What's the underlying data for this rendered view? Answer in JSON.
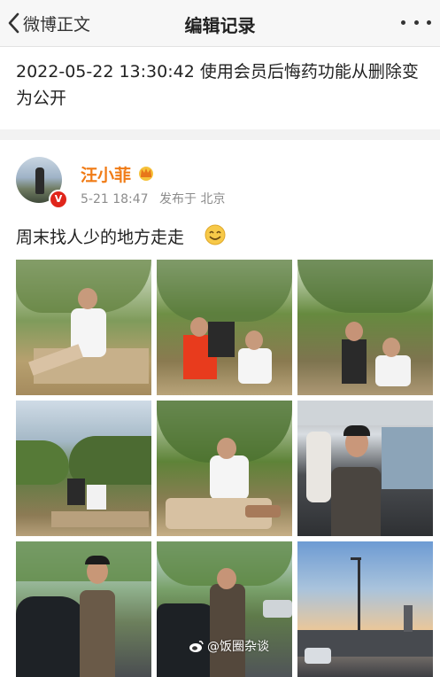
{
  "nav": {
    "back_label": "微博正文",
    "title": "编辑记录"
  },
  "record": {
    "text": "2022-05-22 13:30:42 使用会员后悔药功能从删除变为公开"
  },
  "post": {
    "author": "汪小菲",
    "time": "5-21 18:47",
    "location": "发布于 北京",
    "text": "周末找人少的地方走走",
    "verified_badge": "V"
  },
  "photos": [
    {
      "scene": "park-picnic-man-sitting"
    },
    {
      "scene": "park-group-three-people"
    },
    {
      "scene": "park-two-men-posing"
    },
    {
      "scene": "park-picnic-wide"
    },
    {
      "scene": "park-picnic-closeup"
    },
    {
      "scene": "car-interior-man"
    },
    {
      "scene": "man-by-car-street"
    },
    {
      "scene": "man-by-car-trees"
    },
    {
      "scene": "sunset-city-road"
    }
  ],
  "watermark": {
    "text": "@饭圈杂谈"
  },
  "colors": {
    "username": "#f07b15",
    "verified": "#e0261b",
    "nav_bg": "#f7f7f7"
  },
  "icons": [
    "back-chevron-icon",
    "more-dots-icon",
    "crown-icon",
    "smile-emoji-icon",
    "weibo-logo-icon"
  ]
}
